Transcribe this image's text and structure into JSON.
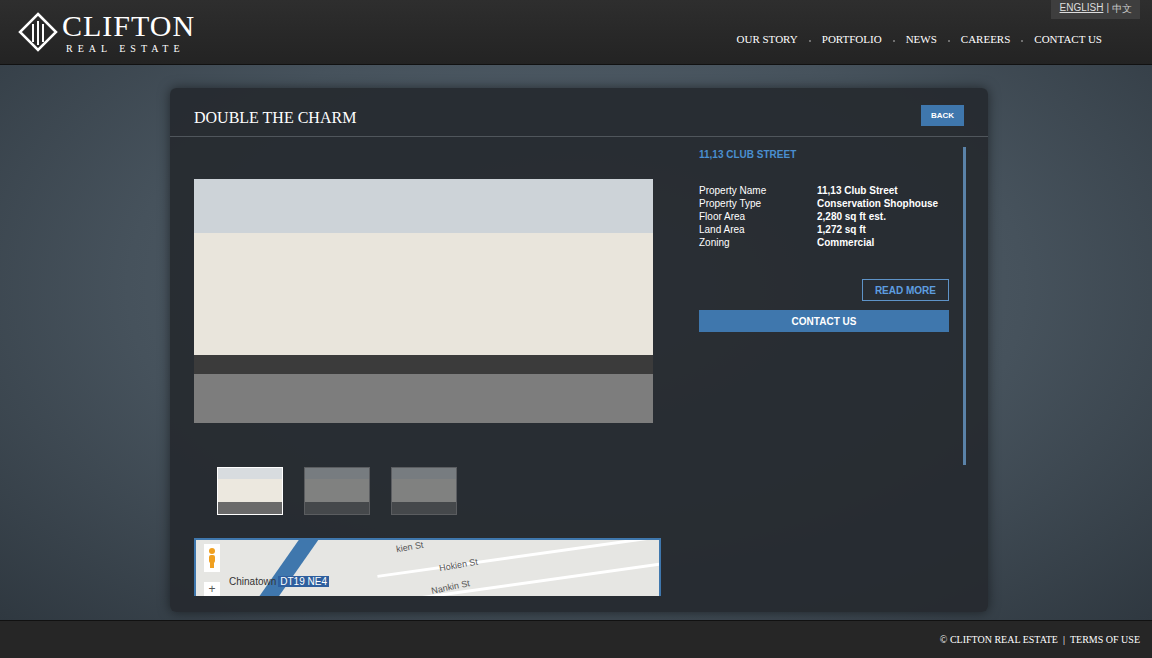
{
  "header": {
    "logo": {
      "name": "CLIFTON",
      "tagline": "REAL ESTATE"
    },
    "languages": [
      {
        "label": "ENGLISH",
        "selected": true
      },
      {
        "label": "中文",
        "selected": false
      }
    ],
    "language_separator": "|",
    "nav": [
      {
        "label": "OUR STORY",
        "selected": false
      },
      {
        "label": "PORTFOLIO",
        "selected": false
      },
      {
        "label": "NEWS",
        "selected": false
      },
      {
        "label": "CAREERS",
        "selected": false
      },
      {
        "label": "CONTACT US",
        "selected": false
      }
    ]
  },
  "panel": {
    "title": "DOUBLE THE CHARM",
    "back_button": "BACK",
    "property_heading": "11,13 CLUB STREET",
    "details": [
      {
        "label": "Property Name",
        "value": "11,13 Club Street"
      },
      {
        "label": "Property Type",
        "value": "Conservation Shophouse"
      },
      {
        "label": "Floor Area",
        "value": "2,280 sq ft est."
      },
      {
        "label": "Land Area",
        "value": "1,272 sq ft"
      },
      {
        "label": "Zoning",
        "value": "Commercial"
      }
    ],
    "read_more": "READ MORE",
    "contact_button": "CONTACT US",
    "thumbnails": [
      {
        "selected": true
      },
      {
        "selected": false
      },
      {
        "selected": false
      }
    ],
    "map": {
      "station": "Chinatown",
      "station_code": "DT19 NE4",
      "streets": [
        "kien St",
        "Hokien St",
        "Nankin St"
      ],
      "zoom_in": "+"
    }
  },
  "footer": {
    "copyright": "© CLIFTON REAL ESTATE",
    "separator": "|",
    "terms": "TERMS OF USE"
  }
}
